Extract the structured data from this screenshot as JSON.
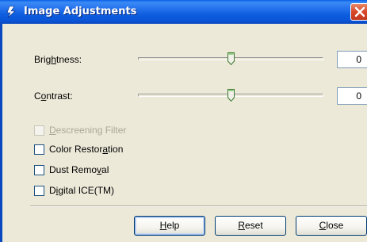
{
  "window": {
    "title": "Image Adjustments"
  },
  "brightness": {
    "label_pre": "Brig",
    "label_mnemonic": "h",
    "label_post": "tness:",
    "value": "0",
    "level": 0.5
  },
  "contrast": {
    "label_pre": "C",
    "label_mnemonic": "o",
    "label_post": "ntrast:",
    "value": "0",
    "level": 0.5
  },
  "options": {
    "descreening": {
      "label_pre": "",
      "label_mnemonic": "D",
      "label_post": "escreening Filter",
      "checked": false,
      "enabled": false
    },
    "color_restoration": {
      "label_pre": "Color Restor",
      "label_mnemonic": "a",
      "label_post": "tion",
      "checked": false,
      "enabled": true
    },
    "dust_removal": {
      "label_pre": "Dust Remo",
      "label_mnemonic": "v",
      "label_post": "al",
      "checked": false,
      "enabled": true
    },
    "digital_ice": {
      "label_pre": "D",
      "label_mnemonic": "i",
      "label_post": "gital ICE(TM)",
      "checked": false,
      "enabled": true
    }
  },
  "buttons": {
    "help": {
      "pre": "",
      "mnemonic": "H",
      "post": "elp"
    },
    "reset": {
      "pre": "",
      "mnemonic": "R",
      "post": "eset"
    },
    "close": {
      "pre": "",
      "mnemonic": "C",
      "post": "lose"
    }
  },
  "icons": {
    "title": "epson-scan-icon",
    "close": "close-icon",
    "slider_thumb": "slider-thumb"
  },
  "colors": {
    "titlebar": "#0A5FE6",
    "face": "#ECE9D8",
    "close_button": "#D9472A"
  }
}
